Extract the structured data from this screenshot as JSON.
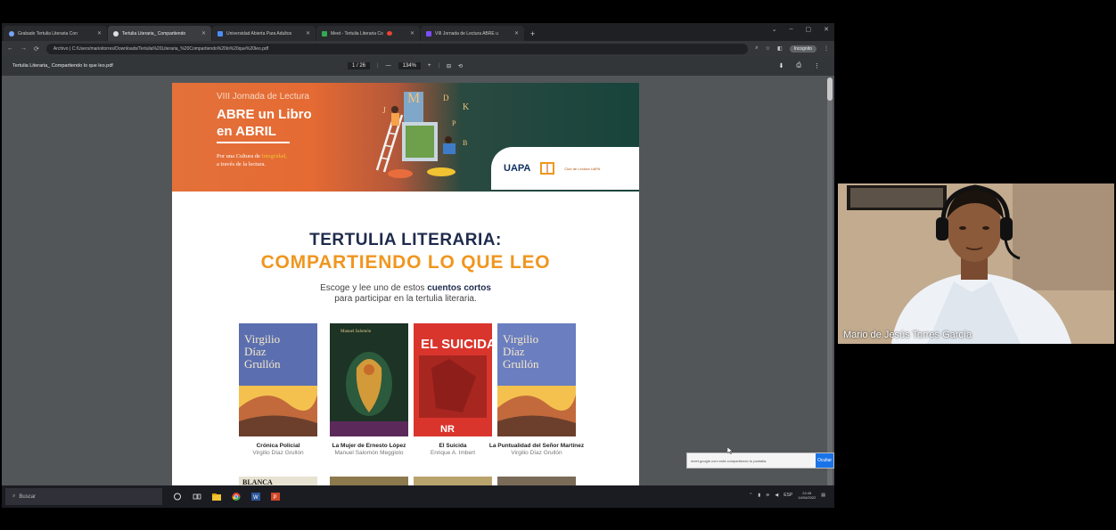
{
  "browser": {
    "tabs": [
      {
        "label": "Grabado Tertulia Literaria Con",
        "active": false
      },
      {
        "label": "Tertulia Literaria_ Compartiendo",
        "active": true
      },
      {
        "label": "Universidad Abierta Para Adultos",
        "active": false
      },
      {
        "label": "Meet - Tertulia Literaria Co",
        "active": false
      },
      {
        "label": "VIII Jornada de Lectura ABRE u",
        "active": false
      }
    ],
    "new_tab": "+",
    "window_controls": [
      "⌄",
      "–",
      "▢",
      "✕"
    ],
    "nav": [
      "←",
      "→",
      "⟳"
    ],
    "url": "Archivo | C:/Users/marioitorres/Downloads/Tertulia%20Literaria_%20Compartiendo%20lo%20que%20leo.pdf",
    "incognito_label": "Incognito"
  },
  "pdf": {
    "title": "Tertulia Literaria_ Compartiendo lo que leo.pdf",
    "page_label": "1 / 26",
    "zoom": "134%",
    "minus": "—",
    "plus": "+"
  },
  "document": {
    "jornada": "VIII Jornada de Lectura",
    "abre_line1": "ABRE un Libro",
    "abre_line2": "en ABRIL",
    "cultura_line1_pre": "Por una Cultura de",
    "cultura_highlight": "Integridad,",
    "cultura_line2": "a través de la lectura.",
    "logo_uapa": "UAPA",
    "logo_club": "Club de Lectura UAPA",
    "heading1": "TERTULIA LITERARIA:",
    "heading2": "COMPARTIENDO LO QUE LEO",
    "desc_pre": "Escoge y lee uno de estos",
    "desc_bold": "cuentos cortos",
    "desc_line2": "para participar en la tertulia literaria.",
    "books": [
      {
        "cover_text": "Virgilio Díaz Grullón",
        "title": "Crónica Policial",
        "author": "Virgilio Díaz Grullón"
      },
      {
        "cover_text": "Manuel Salomón",
        "title": "La Mujer de Ernesto López",
        "author": "Manuel Salomón Meggiolo"
      },
      {
        "cover_text": "EL SUICIDA",
        "title": "El Suicida",
        "author": "Enrique A. Imbert"
      },
      {
        "cover_text": "Virgilio Díaz Grullón",
        "title": "La Puntualidad del Señor Martínez",
        "author": "Virgilio Díaz Grullón"
      }
    ],
    "row2_first": "BLANCA"
  },
  "popup": {
    "url": "meet.google.com está compartiendo tu pantalla.",
    "button": "Ocultar"
  },
  "taskbar": {
    "search_placeholder": "Buscar",
    "tray_lang": "ESP",
    "time": "22:45",
    "date": "14/04/2022"
  },
  "participant": {
    "name": "Mario de Jesús Torres García"
  },
  "colors": {
    "accent_orange": "#f0961f",
    "heading_navy": "#1f2b4d",
    "banner_green": "#17443c"
  }
}
